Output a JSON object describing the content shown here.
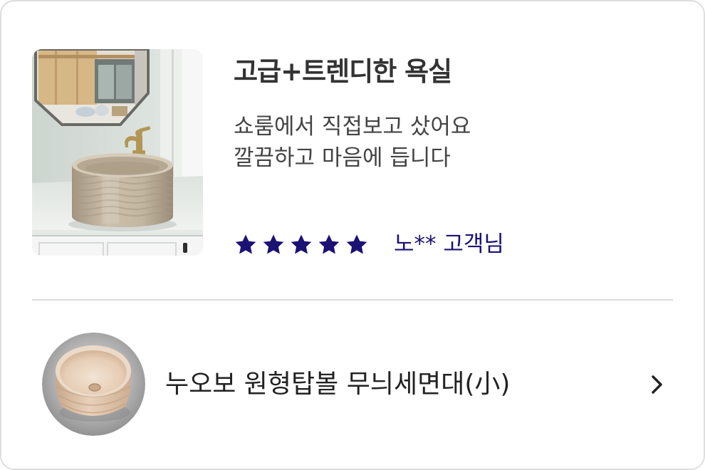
{
  "review": {
    "title": "고급+트렌디한 욕실",
    "body_lines": [
      "쇼룸에서 직접보고 샀어요",
      "깔끔하고 마음에 듭니다"
    ],
    "rating": 5,
    "max_rating": 5,
    "reviewer": "노** 고객님",
    "photo_icon": "bathroom-sink-photo"
  },
  "product": {
    "name": "누오보 원형탑볼 무늬세면대(小)",
    "thumbnail_icon": "round-basin-thumbnail",
    "link_icon": "chevron-right-icon"
  },
  "colors": {
    "accent": "#1b1274",
    "star_filled": "#1b1274",
    "star_empty": "#cccccc",
    "title": "#333333",
    "body": "#444444",
    "divider": "#dcdcdc",
    "border": "#dedede"
  }
}
